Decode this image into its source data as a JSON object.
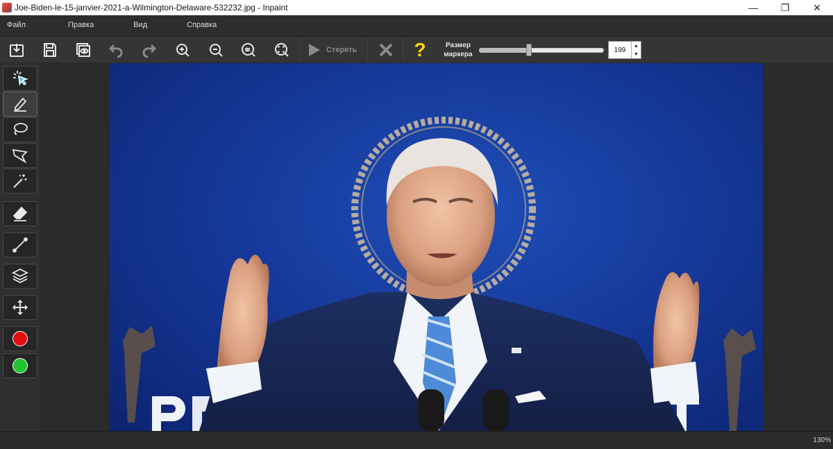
{
  "window": {
    "title": "Joe-Biden-le-15-janvier-2021-a-Wilmington-Delaware-532232.jpg - Inpaint",
    "minimize": "—",
    "restore": "❐",
    "close": "✕"
  },
  "menu": {
    "items": [
      "Файл",
      "Правка",
      "Вид",
      "Справка"
    ]
  },
  "toolbar": {
    "erase_label": "Стереть",
    "marker_label_line1": "Размер",
    "marker_label_line2": "маркера",
    "marker_size": "199",
    "marker_fraction": 0.4,
    "help_glyph": "?"
  },
  "colors": {
    "help": "#ffd400",
    "marker_red": "#e01010",
    "marker_green": "#21c531",
    "icon": "#e8e8e8",
    "disabled": "#8a8a8a"
  },
  "status": {
    "zoom": "130%"
  }
}
